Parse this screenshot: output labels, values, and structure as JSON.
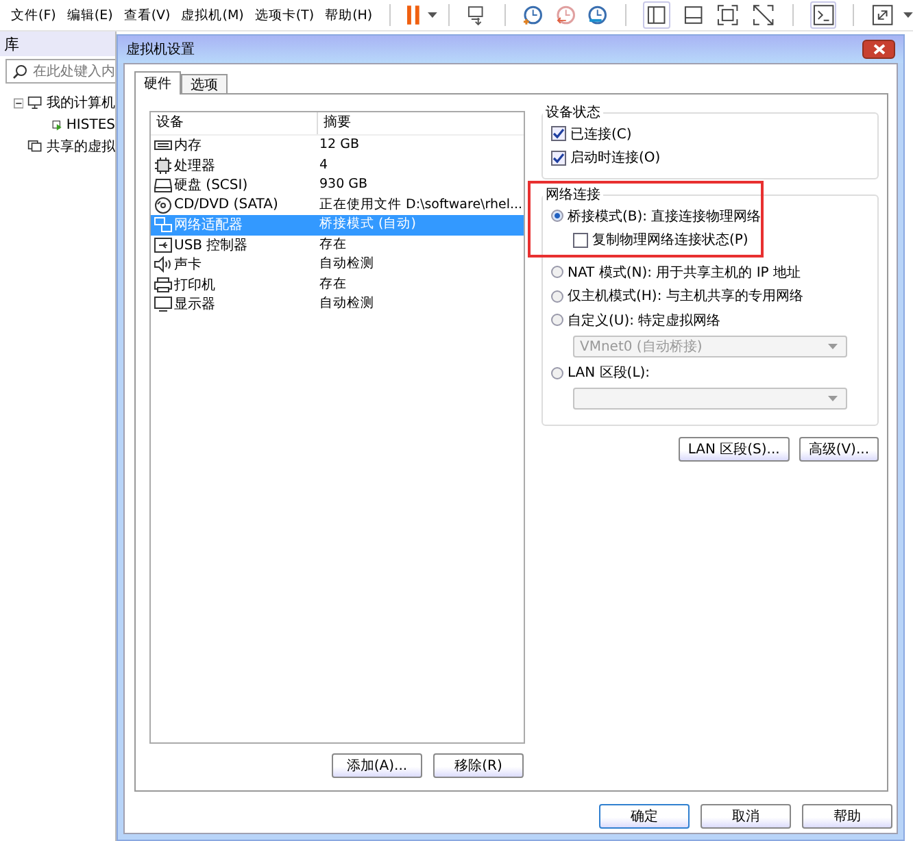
{
  "menu": [
    {
      "label": "文件(F)"
    },
    {
      "label": "编辑(E)"
    },
    {
      "label": "查看(V)"
    },
    {
      "label": "虚拟机(M)"
    },
    {
      "label": "选项卡(T)"
    },
    {
      "label": "帮助(H)"
    }
  ],
  "library": {
    "title": "库",
    "search": {
      "placeholder": "在此处键入内"
    },
    "tree": [
      {
        "label": "我的计算机",
        "kind": "computer",
        "expanded": true,
        "children": [
          {
            "label": "HISTES",
            "kind": "vm"
          }
        ]
      },
      {
        "label": "共享的虚拟",
        "kind": "shared"
      }
    ]
  },
  "dialog": {
    "title": "虚拟机设置",
    "tabs": [
      {
        "label": "硬件",
        "selected": true
      },
      {
        "label": "选项",
        "selected": false
      }
    ],
    "devices": {
      "columns": [
        "设备",
        "摘要"
      ],
      "rows": [
        {
          "kind": "memory",
          "device": "内存",
          "summary": "12 GB",
          "selected": false
        },
        {
          "kind": "cpu",
          "device": "处理器",
          "summary": "4",
          "selected": false
        },
        {
          "kind": "disk",
          "device": "硬盘 (SCSI)",
          "summary": "930 GB",
          "selected": false
        },
        {
          "kind": "cdrom",
          "device": "CD/DVD (SATA)",
          "summary": "正在使用文件 D:\\software\\rhel...",
          "selected": false
        },
        {
          "kind": "network",
          "device": "网络适配器",
          "summary": "桥接模式 (自动)",
          "selected": true
        },
        {
          "kind": "usb",
          "device": "USB 控制器",
          "summary": "存在",
          "selected": false
        },
        {
          "kind": "sound",
          "device": "声卡",
          "summary": "自动检测",
          "selected": false
        },
        {
          "kind": "printer",
          "device": "打印机",
          "summary": "存在",
          "selected": false
        },
        {
          "kind": "display",
          "device": "显示器",
          "summary": "自动检测",
          "selected": false
        }
      ]
    },
    "add_button": "添加(A)...",
    "remove_button": "移除(R)",
    "device_status": {
      "title": "设备状态",
      "options": [
        {
          "label": "已连接(C)",
          "checked": true
        },
        {
          "label": "启动时连接(O)",
          "checked": true
        }
      ]
    },
    "network": {
      "title": "网络连接",
      "modes": [
        {
          "label": "桥接模式(B): 直接连接物理网络",
          "selected": true,
          "option": {
            "label": "复制物理网络连接状态(P)",
            "checked": false
          }
        },
        {
          "label": "NAT 模式(N): 用于共享主机的 IP 地址",
          "selected": false
        },
        {
          "label": "仅主机模式(H): 与主机共享的专用网络",
          "selected": false
        },
        {
          "label": "自定义(U): 特定虚拟网络",
          "selected": false,
          "dropdown": {
            "value": "VMnet0 (自动桥接)",
            "disabled": true
          }
        },
        {
          "label": "LAN 区段(L):",
          "selected": false,
          "dropdown": {
            "disabled": true
          }
        }
      ]
    },
    "network_buttons": [
      "LAN 区段(S)...",
      "高级(V)..."
    ],
    "footer_buttons": [
      "确定",
      "取消",
      "帮助"
    ]
  }
}
